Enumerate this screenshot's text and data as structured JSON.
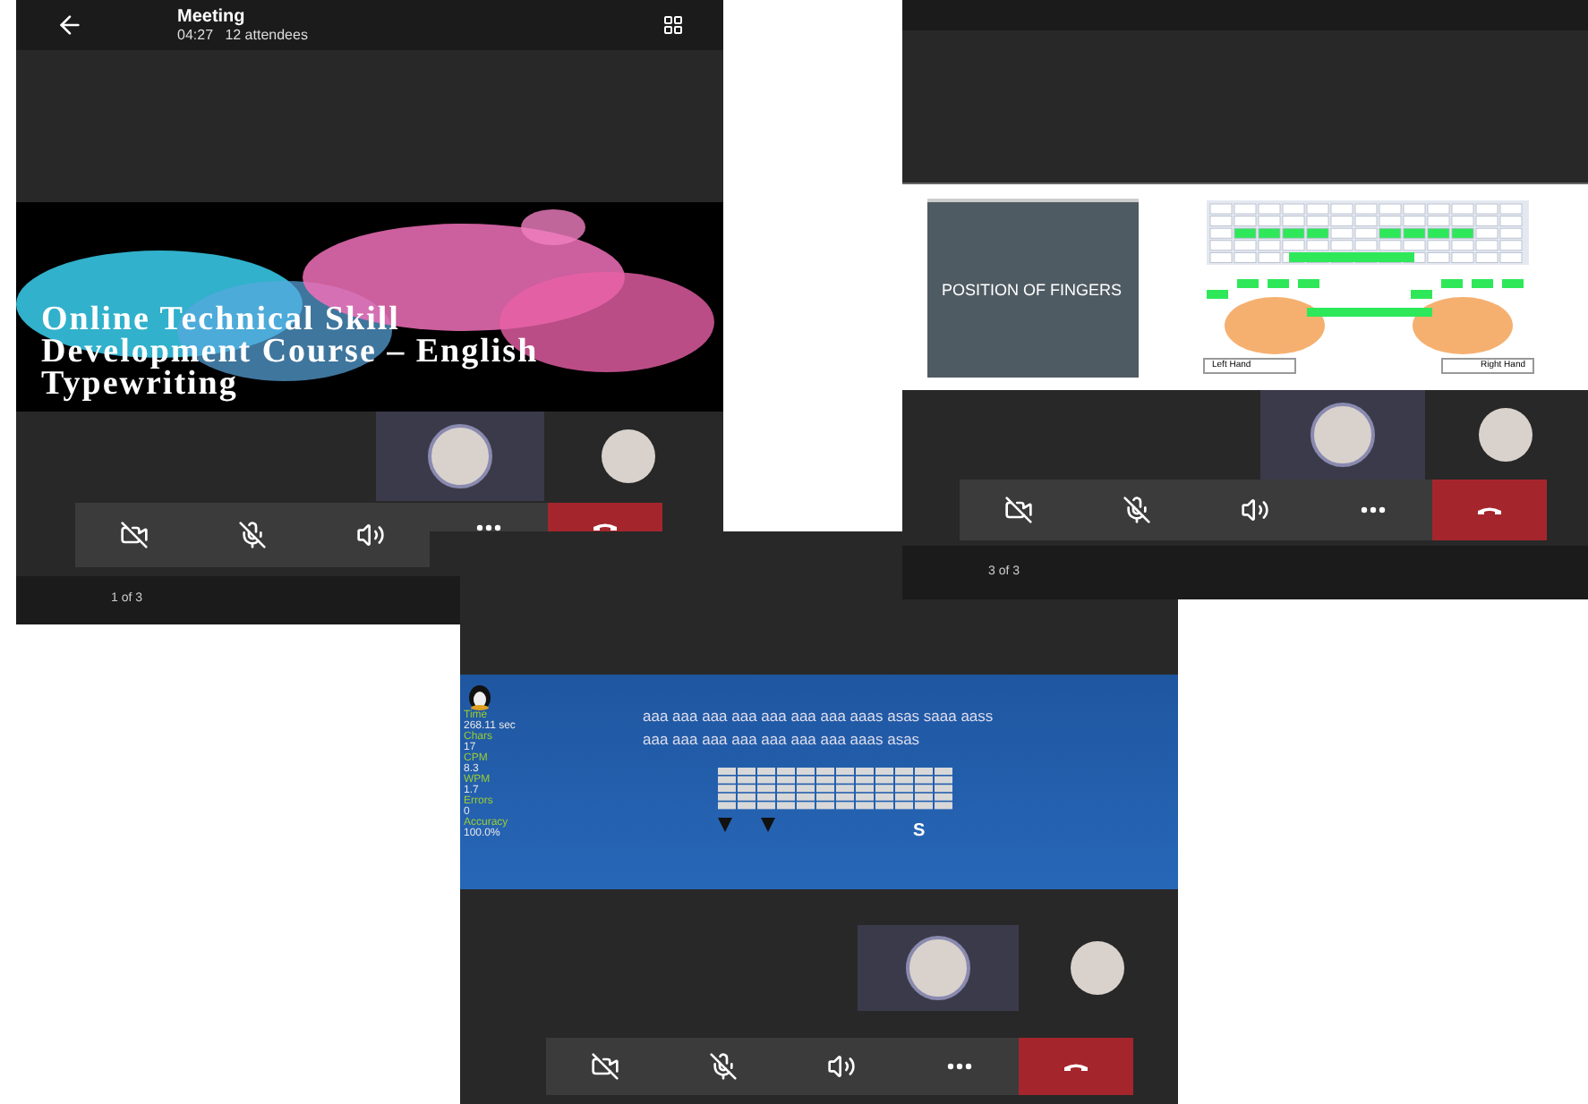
{
  "windows": [
    {
      "kind": "title",
      "header": {
        "title": "Meeting",
        "subtitle": "04:27   12 attendees"
      },
      "slide": {
        "title": "Online Technical Skill Development Course – English Typewriting"
      },
      "participants": [
        {
          "selected": true
        },
        {
          "selected": false
        }
      ],
      "controls": [
        {
          "kind": "camera-off"
        },
        {
          "kind": "mic-off"
        },
        {
          "kind": "speaker"
        },
        {
          "kind": "more"
        },
        {
          "kind": "hang-up"
        }
      ],
      "page": "1 of 3"
    },
    {
      "kind": "fingers",
      "slide": {
        "title": "POSITION OF FINGERS",
        "left_label": "Left Hand",
        "right_label": "Right Hand"
      },
      "participants": [
        {
          "selected": true
        },
        {
          "selected": false
        }
      ],
      "controls": [
        {
          "kind": "camera-off"
        },
        {
          "kind": "mic-off"
        },
        {
          "kind": "speaker"
        },
        {
          "kind": "more"
        },
        {
          "kind": "hang-up"
        }
      ],
      "page": "3 of 3"
    },
    {
      "kind": "typing",
      "slide": {
        "stats": [
          {
            "label": "Time",
            "value": "268.11 sec"
          },
          {
            "label": "Chars",
            "value": "17"
          },
          {
            "label": "CPM",
            "value": "8.3"
          },
          {
            "label": "WPM",
            "value": "1.7"
          },
          {
            "label": "Errors",
            "value": "0"
          },
          {
            "label": "Accuracy",
            "value": "100.0%"
          }
        ],
        "lines": [
          "aaa aaa aaa aaa aaa aaa aaa aaas asas saaa aass",
          "aaa aaa aaa aaa aaa aaa aaa aaas asas"
        ],
        "next_key": "S"
      },
      "participants": [
        {
          "selected": true
        },
        {
          "selected": false
        }
      ],
      "controls": [
        {
          "kind": "camera-off"
        },
        {
          "kind": "mic-off"
        },
        {
          "kind": "speaker"
        },
        {
          "kind": "more"
        },
        {
          "kind": "hang-up"
        }
      ]
    }
  ]
}
